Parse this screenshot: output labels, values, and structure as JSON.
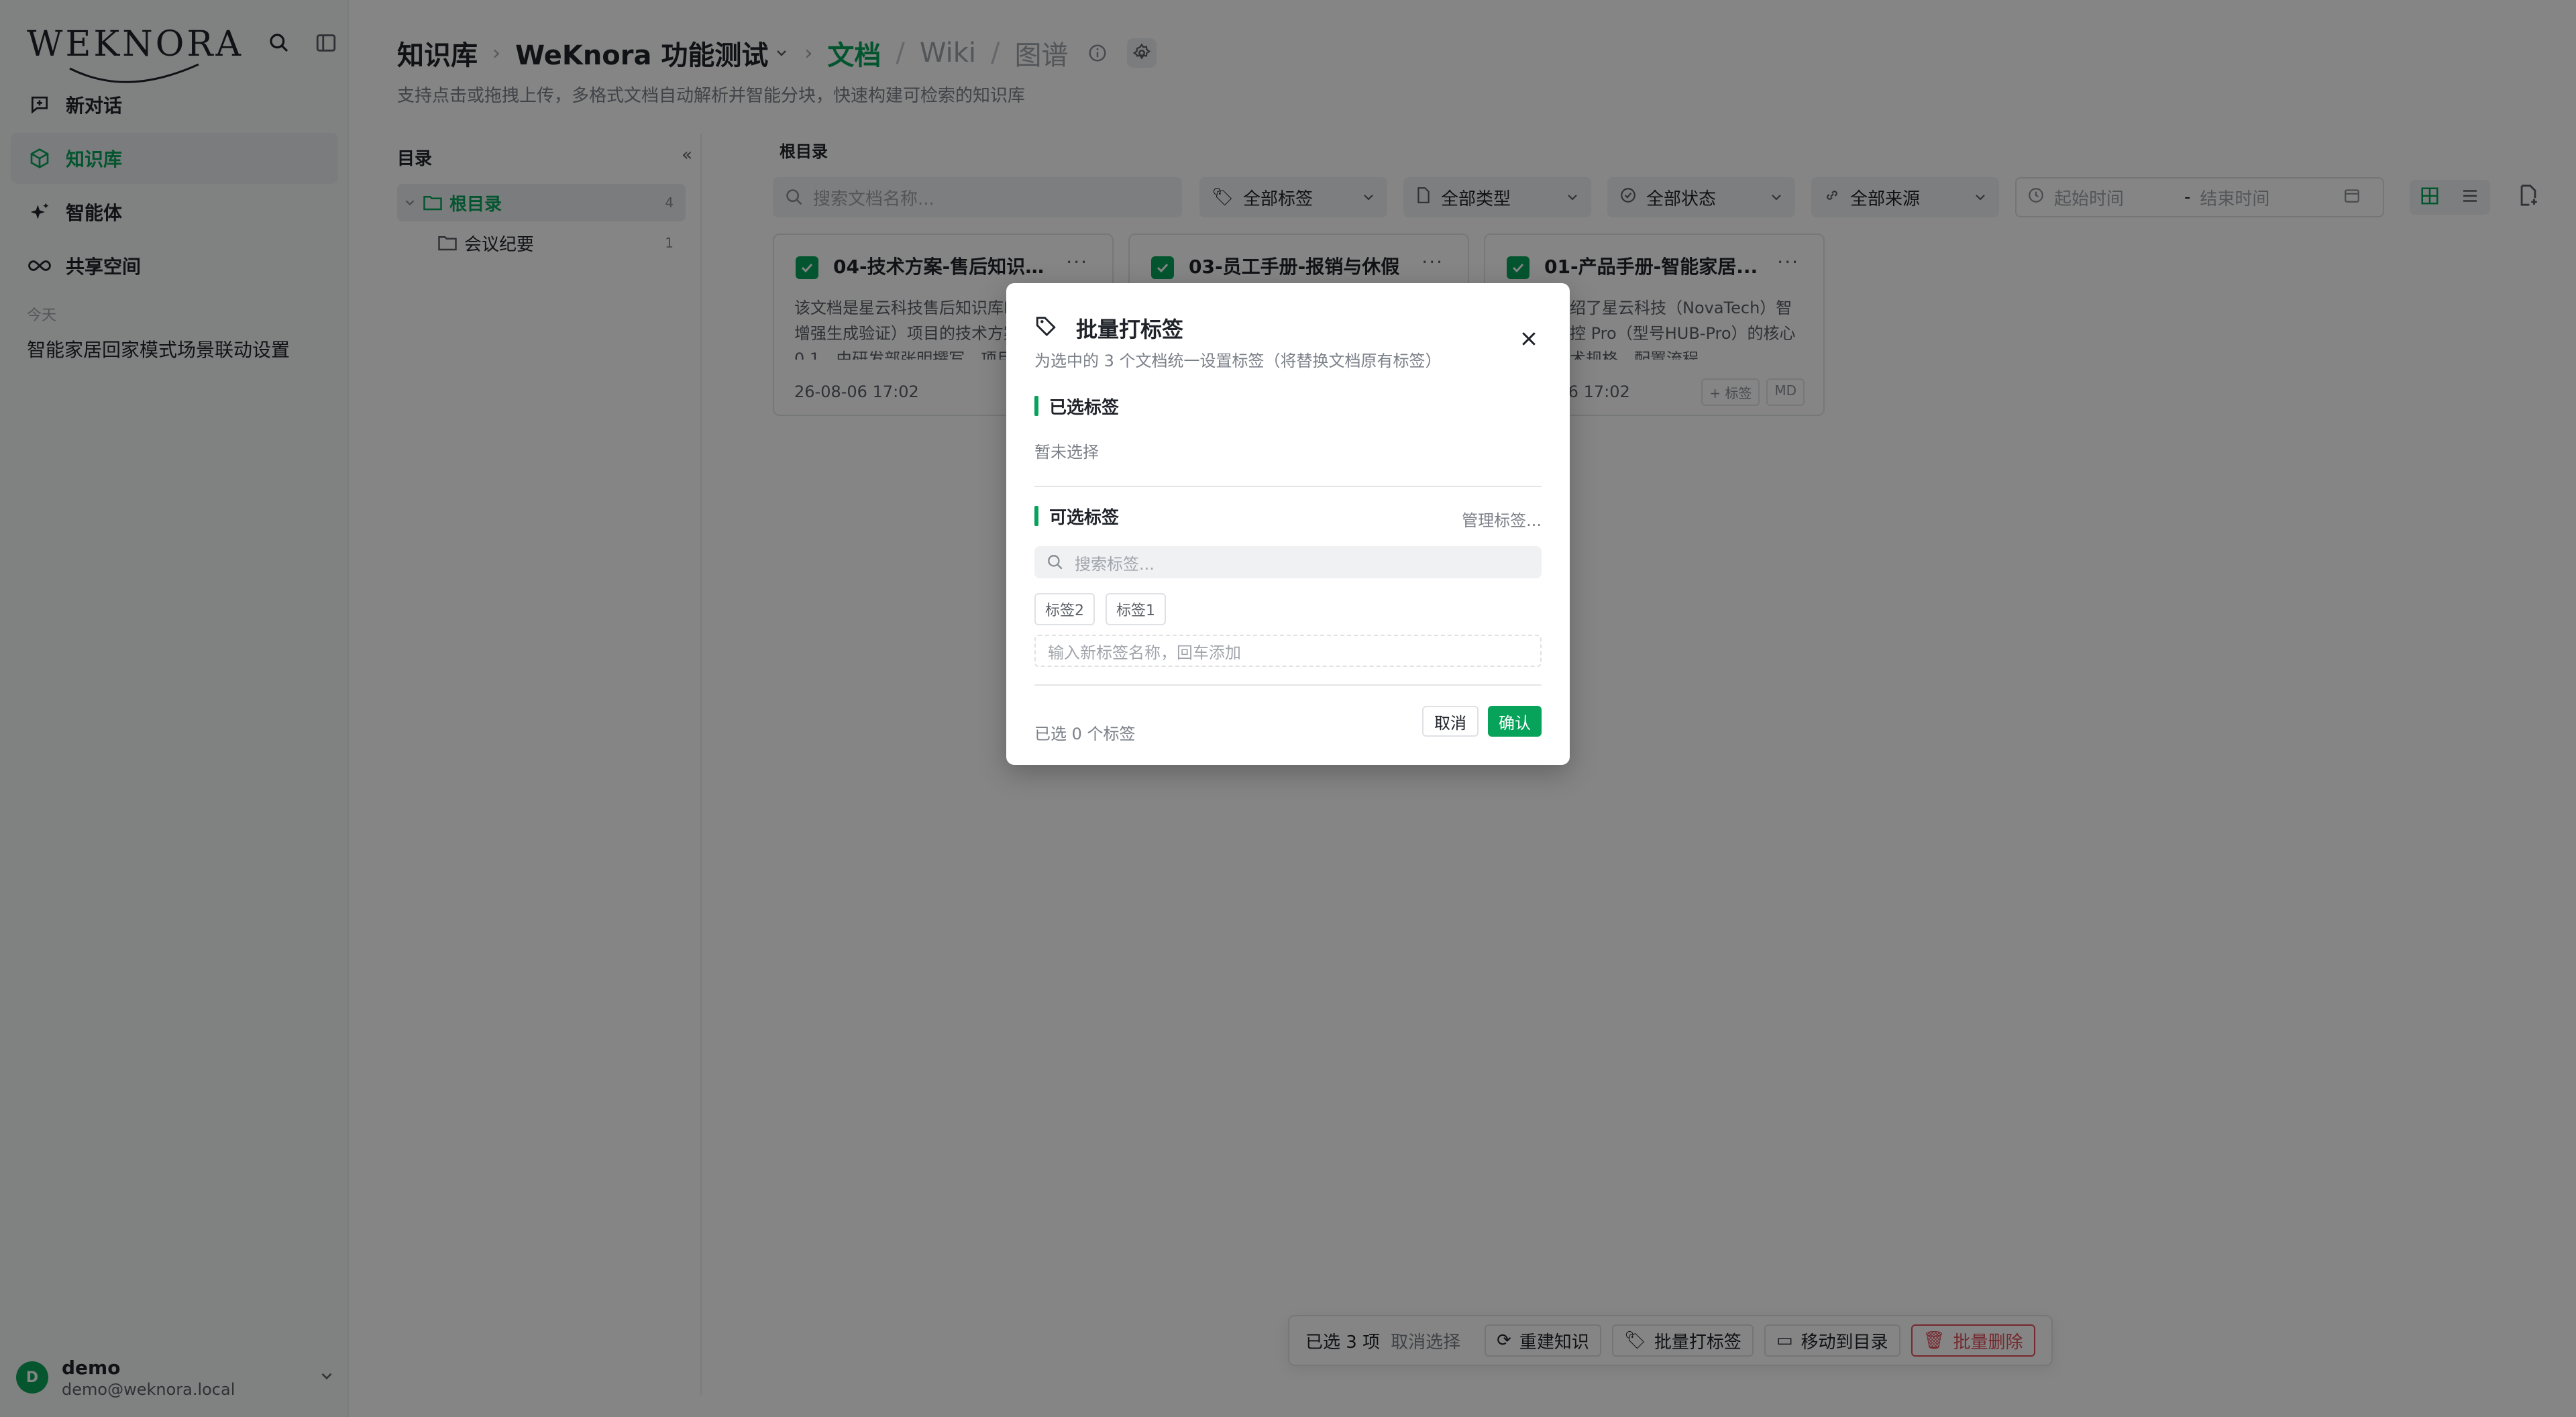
{
  "colors": {
    "brand": "#07a35a",
    "danger": "#e34d59"
  },
  "sidebar": {
    "logo": "WEKNORA",
    "nav": [
      {
        "label": "新对话",
        "icon": "chat-plus-icon"
      },
      {
        "label": "知识库",
        "icon": "cube-icon",
        "active": true
      },
      {
        "label": "智能体",
        "icon": "sparkle-icon"
      },
      {
        "label": "共享空间",
        "icon": "infinity-icon"
      }
    ],
    "history_section": "今天",
    "history": [
      "智能家居回家模式场景联动设置"
    ],
    "user": {
      "avatar": "D",
      "name": "demo",
      "email": "demo@weknora.local"
    }
  },
  "header": {
    "kb_label": "知识库",
    "kb_name": "WeKnora 功能测试",
    "tabs": [
      "文档",
      "Wiki",
      "图谱"
    ],
    "subtitle": "支持点击或拖拽上传，多格式文档自动解析并智能分块，快速构建可检索的知识库"
  },
  "tree": {
    "title": "目录",
    "items": [
      {
        "label": "根目录",
        "count": "4"
      },
      {
        "label": "会议纪要",
        "count": "1"
      }
    ]
  },
  "content": {
    "title": "根目录",
    "search_placeholder": "搜索文档名称...",
    "filters": [
      "全部标签",
      "全部类型",
      "全部状态",
      "全部来源"
    ],
    "date_start": "起始时间",
    "date_sep": "-",
    "date_end": "结束时间",
    "cards": [
      {
        "title": "04-技术方案-售后知识库...",
        "desc": "该文档是星云科技售后知识库RAG（检索增强生成验证）项目的技术方案，版本0.1，由研发部张明撰写，项目代号为…",
        "time": "26-08-06 17:02"
      },
      {
        "title": "03-员工手册-报销与休假",
        "desc": "",
        "time": ""
      },
      {
        "title": "01-产品手册-智能家居...",
        "desc": "该手册介绍了星云科技（NovaTech）智能家居中控 Pro（型号HUB-Pro）的核心功能、技术规格、配置流程…",
        "time": "26-08-06 17:02",
        "tag_add": "+ 标签",
        "type": "MD"
      }
    ]
  },
  "bottom_bar": {
    "selected": "已选 3 项",
    "clear": "取消选择",
    "actions": [
      "重建知识",
      "批量打标签",
      "移动到目录",
      "批量删除"
    ]
  },
  "modal": {
    "title": "批量打标签",
    "subtitle": "为选中的 3 个文档统一设置标签（将替换文档原有标签）",
    "selected_section": "已选标签",
    "empty": "暂未选择",
    "available_section": "可选标签",
    "manage": "管理标签...",
    "search_placeholder": "搜索标签...",
    "tags": [
      "标签2",
      "标签1"
    ],
    "new_tag_placeholder": "输入新标签名称，回车添加",
    "count": "已选 0 个标签",
    "cancel": "取消",
    "confirm": "确认"
  }
}
